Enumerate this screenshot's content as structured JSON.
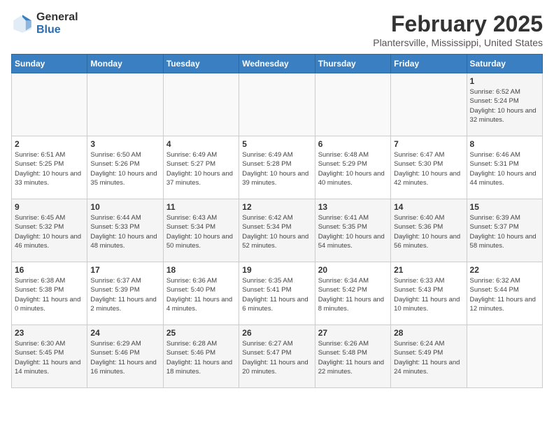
{
  "header": {
    "logo_general": "General",
    "logo_blue": "Blue",
    "title": "February 2025",
    "subtitle": "Plantersville, Mississippi, United States"
  },
  "weekdays": [
    "Sunday",
    "Monday",
    "Tuesday",
    "Wednesday",
    "Thursday",
    "Friday",
    "Saturday"
  ],
  "weeks": [
    [
      {
        "day": "",
        "info": ""
      },
      {
        "day": "",
        "info": ""
      },
      {
        "day": "",
        "info": ""
      },
      {
        "day": "",
        "info": ""
      },
      {
        "day": "",
        "info": ""
      },
      {
        "day": "",
        "info": ""
      },
      {
        "day": "1",
        "info": "Sunrise: 6:52 AM\nSunset: 5:24 PM\nDaylight: 10 hours and 32 minutes."
      }
    ],
    [
      {
        "day": "2",
        "info": "Sunrise: 6:51 AM\nSunset: 5:25 PM\nDaylight: 10 hours and 33 minutes."
      },
      {
        "day": "3",
        "info": "Sunrise: 6:50 AM\nSunset: 5:26 PM\nDaylight: 10 hours and 35 minutes."
      },
      {
        "day": "4",
        "info": "Sunrise: 6:49 AM\nSunset: 5:27 PM\nDaylight: 10 hours and 37 minutes."
      },
      {
        "day": "5",
        "info": "Sunrise: 6:49 AM\nSunset: 5:28 PM\nDaylight: 10 hours and 39 minutes."
      },
      {
        "day": "6",
        "info": "Sunrise: 6:48 AM\nSunset: 5:29 PM\nDaylight: 10 hours and 40 minutes."
      },
      {
        "day": "7",
        "info": "Sunrise: 6:47 AM\nSunset: 5:30 PM\nDaylight: 10 hours and 42 minutes."
      },
      {
        "day": "8",
        "info": "Sunrise: 6:46 AM\nSunset: 5:31 PM\nDaylight: 10 hours and 44 minutes."
      }
    ],
    [
      {
        "day": "9",
        "info": "Sunrise: 6:45 AM\nSunset: 5:32 PM\nDaylight: 10 hours and 46 minutes."
      },
      {
        "day": "10",
        "info": "Sunrise: 6:44 AM\nSunset: 5:33 PM\nDaylight: 10 hours and 48 minutes."
      },
      {
        "day": "11",
        "info": "Sunrise: 6:43 AM\nSunset: 5:34 PM\nDaylight: 10 hours and 50 minutes."
      },
      {
        "day": "12",
        "info": "Sunrise: 6:42 AM\nSunset: 5:34 PM\nDaylight: 10 hours and 52 minutes."
      },
      {
        "day": "13",
        "info": "Sunrise: 6:41 AM\nSunset: 5:35 PM\nDaylight: 10 hours and 54 minutes."
      },
      {
        "day": "14",
        "info": "Sunrise: 6:40 AM\nSunset: 5:36 PM\nDaylight: 10 hours and 56 minutes."
      },
      {
        "day": "15",
        "info": "Sunrise: 6:39 AM\nSunset: 5:37 PM\nDaylight: 10 hours and 58 minutes."
      }
    ],
    [
      {
        "day": "16",
        "info": "Sunrise: 6:38 AM\nSunset: 5:38 PM\nDaylight: 11 hours and 0 minutes."
      },
      {
        "day": "17",
        "info": "Sunrise: 6:37 AM\nSunset: 5:39 PM\nDaylight: 11 hours and 2 minutes."
      },
      {
        "day": "18",
        "info": "Sunrise: 6:36 AM\nSunset: 5:40 PM\nDaylight: 11 hours and 4 minutes."
      },
      {
        "day": "19",
        "info": "Sunrise: 6:35 AM\nSunset: 5:41 PM\nDaylight: 11 hours and 6 minutes."
      },
      {
        "day": "20",
        "info": "Sunrise: 6:34 AM\nSunset: 5:42 PM\nDaylight: 11 hours and 8 minutes."
      },
      {
        "day": "21",
        "info": "Sunrise: 6:33 AM\nSunset: 5:43 PM\nDaylight: 11 hours and 10 minutes."
      },
      {
        "day": "22",
        "info": "Sunrise: 6:32 AM\nSunset: 5:44 PM\nDaylight: 11 hours and 12 minutes."
      }
    ],
    [
      {
        "day": "23",
        "info": "Sunrise: 6:30 AM\nSunset: 5:45 PM\nDaylight: 11 hours and 14 minutes."
      },
      {
        "day": "24",
        "info": "Sunrise: 6:29 AM\nSunset: 5:46 PM\nDaylight: 11 hours and 16 minutes."
      },
      {
        "day": "25",
        "info": "Sunrise: 6:28 AM\nSunset: 5:46 PM\nDaylight: 11 hours and 18 minutes."
      },
      {
        "day": "26",
        "info": "Sunrise: 6:27 AM\nSunset: 5:47 PM\nDaylight: 11 hours and 20 minutes."
      },
      {
        "day": "27",
        "info": "Sunrise: 6:26 AM\nSunset: 5:48 PM\nDaylight: 11 hours and 22 minutes."
      },
      {
        "day": "28",
        "info": "Sunrise: 6:24 AM\nSunset: 5:49 PM\nDaylight: 11 hours and 24 minutes."
      },
      {
        "day": "",
        "info": ""
      }
    ]
  ]
}
